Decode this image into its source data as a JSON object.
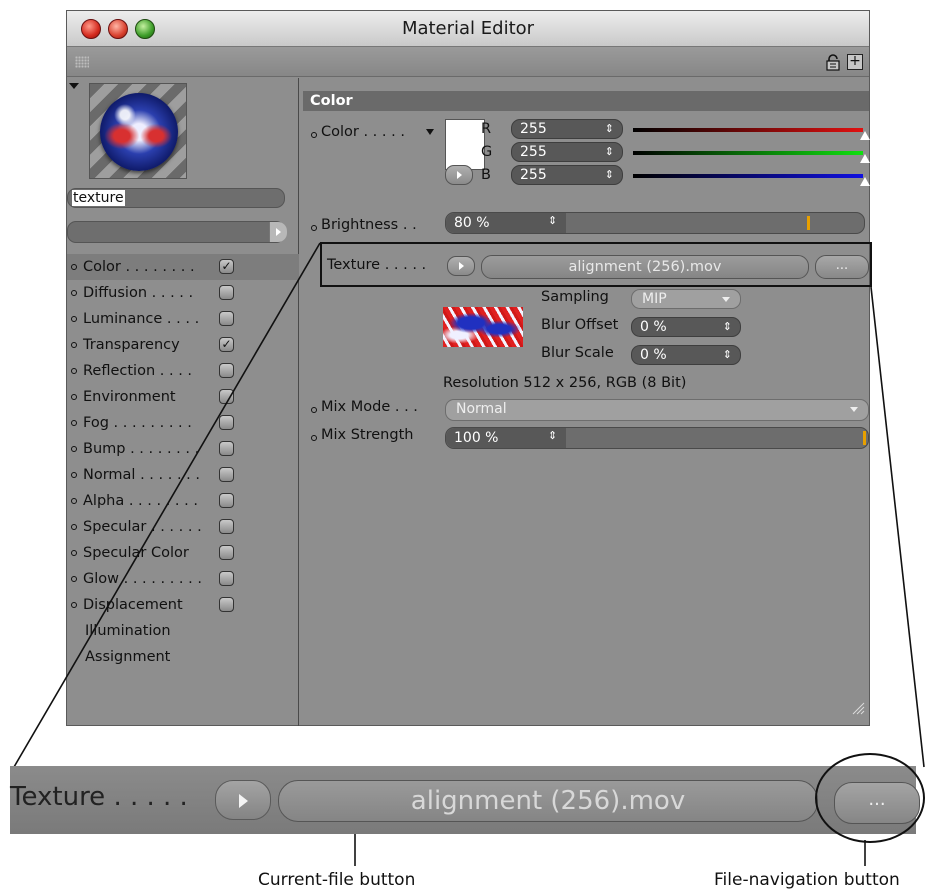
{
  "window": {
    "title": "Material Editor"
  },
  "preview": {
    "material_name": "texture"
  },
  "channels": [
    {
      "label": "Color . . . . . . . .",
      "checked": true,
      "has_dot": true,
      "selected": true
    },
    {
      "label": "Diffusion . . . . .",
      "checked": false,
      "has_dot": true
    },
    {
      "label": "Luminance . . . .",
      "checked": false,
      "has_dot": true
    },
    {
      "label": "Transparency",
      "checked": true,
      "has_dot": true
    },
    {
      "label": "Reflection . . . .",
      "checked": false,
      "has_dot": true
    },
    {
      "label": "Environment",
      "checked": false,
      "has_dot": true
    },
    {
      "label": "Fog . . . . . . . . .",
      "checked": false,
      "has_dot": true
    },
    {
      "label": "Bump . . . . . . . .",
      "checked": false,
      "has_dot": true
    },
    {
      "label": "Normal . . . . . . .",
      "checked": false,
      "has_dot": true
    },
    {
      "label": "Alpha . . . . . . . .",
      "checked": false,
      "has_dot": true
    },
    {
      "label": "Specular . . . . . .",
      "checked": false,
      "has_dot": true
    },
    {
      "label": "Specular Color",
      "checked": false,
      "has_dot": true
    },
    {
      "label": "Glow . . . . . . . . .",
      "checked": false,
      "has_dot": true
    },
    {
      "label": "Displacement",
      "checked": false,
      "has_dot": true
    },
    {
      "label": "Illumination",
      "checked": null,
      "has_dot": false
    },
    {
      "label": "Assignment",
      "checked": null,
      "has_dot": false
    }
  ],
  "color_section": {
    "header": "Color",
    "color_label": "Color . . . . .",
    "swatch_color": "#ffffff",
    "channels": [
      {
        "ch": "R",
        "value": "255",
        "track_color": "#e01010",
        "level": 1.0
      },
      {
        "ch": "G",
        "value": "255",
        "track_color": "#10e010",
        "level": 1.0
      },
      {
        "ch": "B",
        "value": "255",
        "track_color": "#1010e0",
        "level": 1.0
      }
    ],
    "brightness_label": "Brightness . .",
    "brightness_value": "80 %",
    "texture_label": "Texture . . . . .",
    "texture_file": "alignment (256).mov",
    "texture_nav": "...",
    "sampling_label": "Sampling",
    "sampling_value": "MIP",
    "blur_offset_label": "Blur Offset",
    "blur_offset_value": "0 %",
    "blur_scale_label": "Blur Scale",
    "blur_scale_value": "0 %",
    "resolution_text": "Resolution 512 x 256, RGB (8 Bit)",
    "mix_mode_label": "Mix Mode . . .",
    "mix_mode_value": "Normal",
    "mix_strength_label": "Mix Strength",
    "mix_strength_value": "100 %"
  },
  "zoom": {
    "label": "Texture . . . . .",
    "file": "alignment (256).mov",
    "nav": "..."
  },
  "captions": {
    "current_file": "Current-file button",
    "file_navigation": "File-navigation button"
  },
  "icons": {
    "close": "close-light-icon",
    "minimize": "minimize-light-icon",
    "zoom": "zoom-light-icon",
    "lock": "lock-icon",
    "new_window": "plus-box-icon",
    "grip": "grip-icon",
    "resize": "resize-grip-icon"
  },
  "accent_colors": {
    "slider_marker": "#e8a000",
    "section_header": "#6a6a6a"
  }
}
